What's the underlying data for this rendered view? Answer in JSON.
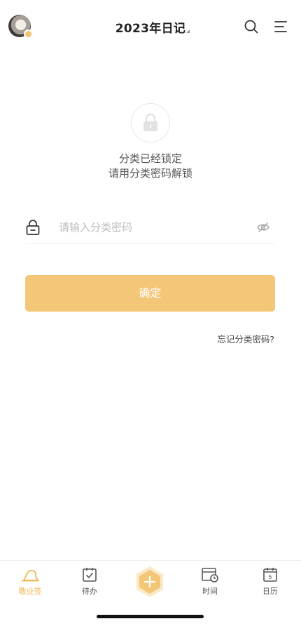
{
  "header": {
    "title": "2023年日记",
    "avatar_icon": "user-avatar",
    "search_icon": "search-icon",
    "menu_icon": "menu-icon"
  },
  "lock_screen": {
    "icon": "lock-icon",
    "message_line1": "分类已经锁定",
    "message_line2": "请用分类密码解锁",
    "password_placeholder": "请输入分类密码",
    "password_value": "",
    "confirm_label": "确定",
    "forgot_label": "忘记分类密码?"
  },
  "tabbar": {
    "items": [
      {
        "label": "敬业签",
        "icon": "cloud-note-icon",
        "active": true
      },
      {
        "label": "待办",
        "icon": "todo-calendar-icon",
        "active": false
      },
      {
        "label": "",
        "icon": "add-icon",
        "active": false
      },
      {
        "label": "时间",
        "icon": "time-calendar-icon",
        "active": false
      },
      {
        "label": "日历",
        "icon": "calendar-icon",
        "active": false
      }
    ],
    "calendar_day": "5"
  },
  "colors": {
    "accent": "#F3C678",
    "accent_active_text": "#F0B44C"
  }
}
